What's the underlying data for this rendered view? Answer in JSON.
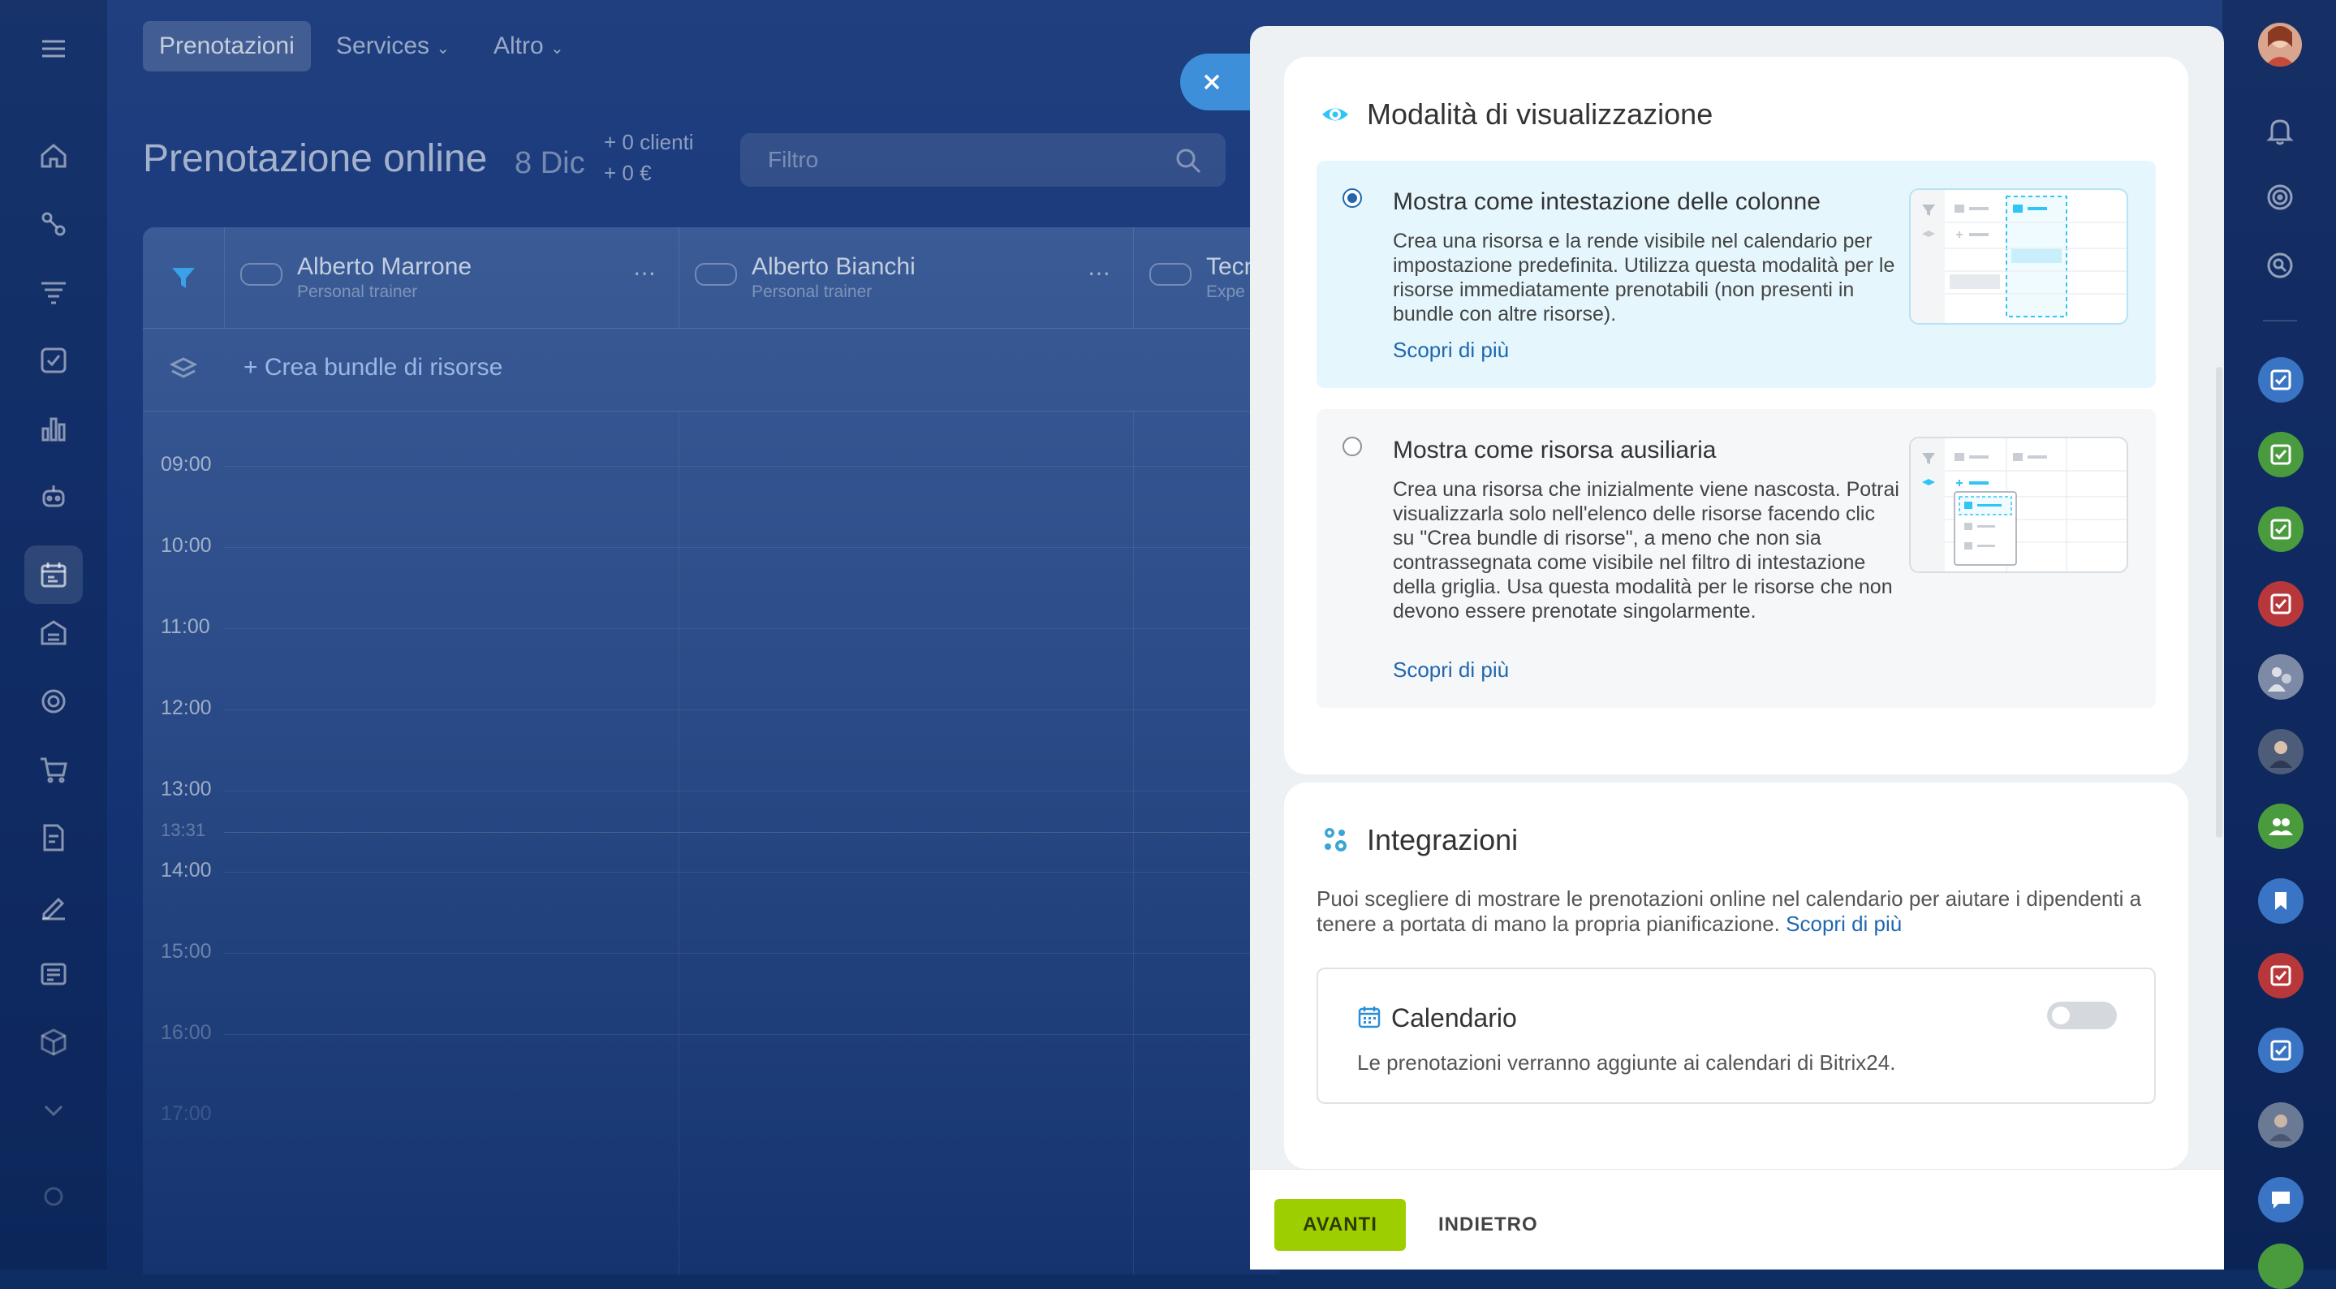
{
  "colors": {
    "accent": "#2067b0",
    "primary_button": "#9dcf00",
    "selected_option_bg": "#e5f7fd",
    "view_icon": "#2fc6f6"
  },
  "top_nav": {
    "tab_bookings": "Prenotazioni",
    "tab_services": "Services",
    "tab_more": "Altro"
  },
  "page": {
    "title": "Prenotazione online",
    "date": "8 Dic",
    "clients_stat": "+ 0 clienti",
    "revenue_stat": "+ 0 €",
    "filter_placeholder": "Filtro"
  },
  "grid": {
    "resources": [
      {
        "name": "Alberto Marrone",
        "role": "Personal trainer"
      },
      {
        "name": "Alberto Bianchi",
        "role": "Personal trainer"
      },
      {
        "name": "Tecn",
        "role": "Expe"
      }
    ],
    "bundle_link": "+ Crea bundle di risorse",
    "times": [
      "09:00",
      "10:00",
      "11:00",
      "12:00",
      "13:00",
      "13:31",
      "14:00",
      "15:00",
      "16:00",
      "17:00"
    ]
  },
  "view_mode": {
    "title": "Modalità di visualizzazione",
    "option_columns": {
      "title": "Mostra come intestazione delle colonne",
      "description": "Crea una risorsa e la rende visibile nel calendario per impostazione predefinita. Utilizza questa modalità per le risorse immediatamente prenotabili (non presenti in bundle con altre risorse).",
      "link": "Scopri di più",
      "selected": true
    },
    "option_auxiliary": {
      "title": "Mostra come risorsa ausiliaria",
      "description": "Crea una risorsa che inizialmente viene nascosta. Potrai visualizzarla solo nell'elenco delle risorse facendo clic su \"Crea bundle di risorse\", a meno che non sia contrassegnata come visibile nel filtro di intestazione della griglia. Usa questa modalità per le risorse che non devono essere prenotate singolarmente.",
      "link": "Scopri di più",
      "selected": false
    }
  },
  "integrations": {
    "title": "Integrazioni",
    "description": "Puoi scegliere di mostrare le prenotazioni online nel calendario per aiutare i dipendenti a tenere a portata di mano la propria pianificazione.",
    "link": "Scopri di più",
    "calendar": {
      "title": "Calendario",
      "description": "Le prenotazioni verranno aggiunte ai calendari di Bitrix24.",
      "enabled": false
    }
  },
  "footer": {
    "next_label": "AVANTI",
    "back_label": "INDIETRO"
  }
}
